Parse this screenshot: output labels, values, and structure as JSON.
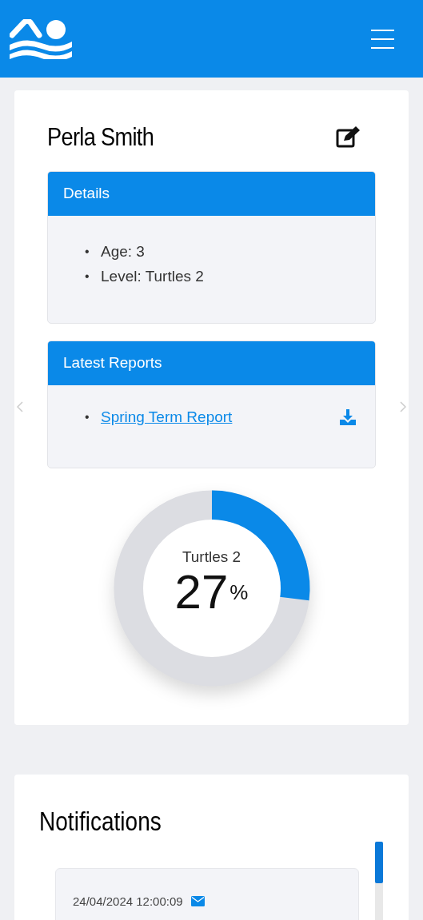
{
  "profile": {
    "name": "Perla Smith"
  },
  "details": {
    "title": "Details",
    "items": [
      {
        "bullet": "•",
        "text": "Age: 3"
      },
      {
        "bullet": "•",
        "text": "Level: Turtles 2"
      }
    ]
  },
  "reports": {
    "title": "Latest Reports",
    "items": [
      {
        "bullet": "•",
        "label": "Spring Term Report"
      }
    ]
  },
  "progress": {
    "label": "Turtles 2",
    "value": "27",
    "unit": "%"
  },
  "notifications": {
    "title": "Notifications",
    "items": [
      {
        "time": "24/04/2024 12:00:09"
      }
    ]
  }
}
